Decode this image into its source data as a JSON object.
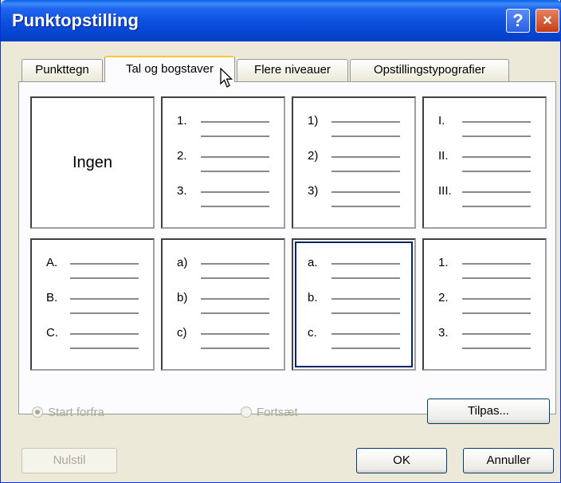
{
  "window": {
    "title": "Punktopstilling",
    "help_glyph": "?",
    "close_glyph": "×"
  },
  "tabs": [
    {
      "label": "Punkttegn",
      "active": false
    },
    {
      "label": "Tal og bogstaver",
      "active": true
    },
    {
      "label": "Flere niveauer",
      "active": false
    },
    {
      "label": "Opstillingstypografier",
      "active": false
    }
  ],
  "styles": [
    {
      "name": "Ingen",
      "markers": []
    },
    {
      "markers": [
        "1.",
        "2.",
        "3."
      ]
    },
    {
      "markers": [
        "1)",
        "2)",
        "3)"
      ]
    },
    {
      "markers": [
        "I.",
        "II.",
        "III."
      ]
    },
    {
      "markers": [
        "A.",
        "B.",
        "C."
      ]
    },
    {
      "markers": [
        "a)",
        "b)",
        "c)"
      ]
    },
    {
      "markers": [
        "a.",
        "b.",
        "c."
      ],
      "selected": true
    },
    {
      "markers": [
        "1.",
        "2.",
        "3."
      ]
    }
  ],
  "numbering": {
    "start_over_label": "Start forfra",
    "continue_label": "Fortsæt",
    "start_over_checked": true,
    "continue_checked": false
  },
  "buttons": {
    "customize": "Tilpas...",
    "reset": "Nulstil",
    "ok": "OK",
    "cancel": "Annuller"
  }
}
